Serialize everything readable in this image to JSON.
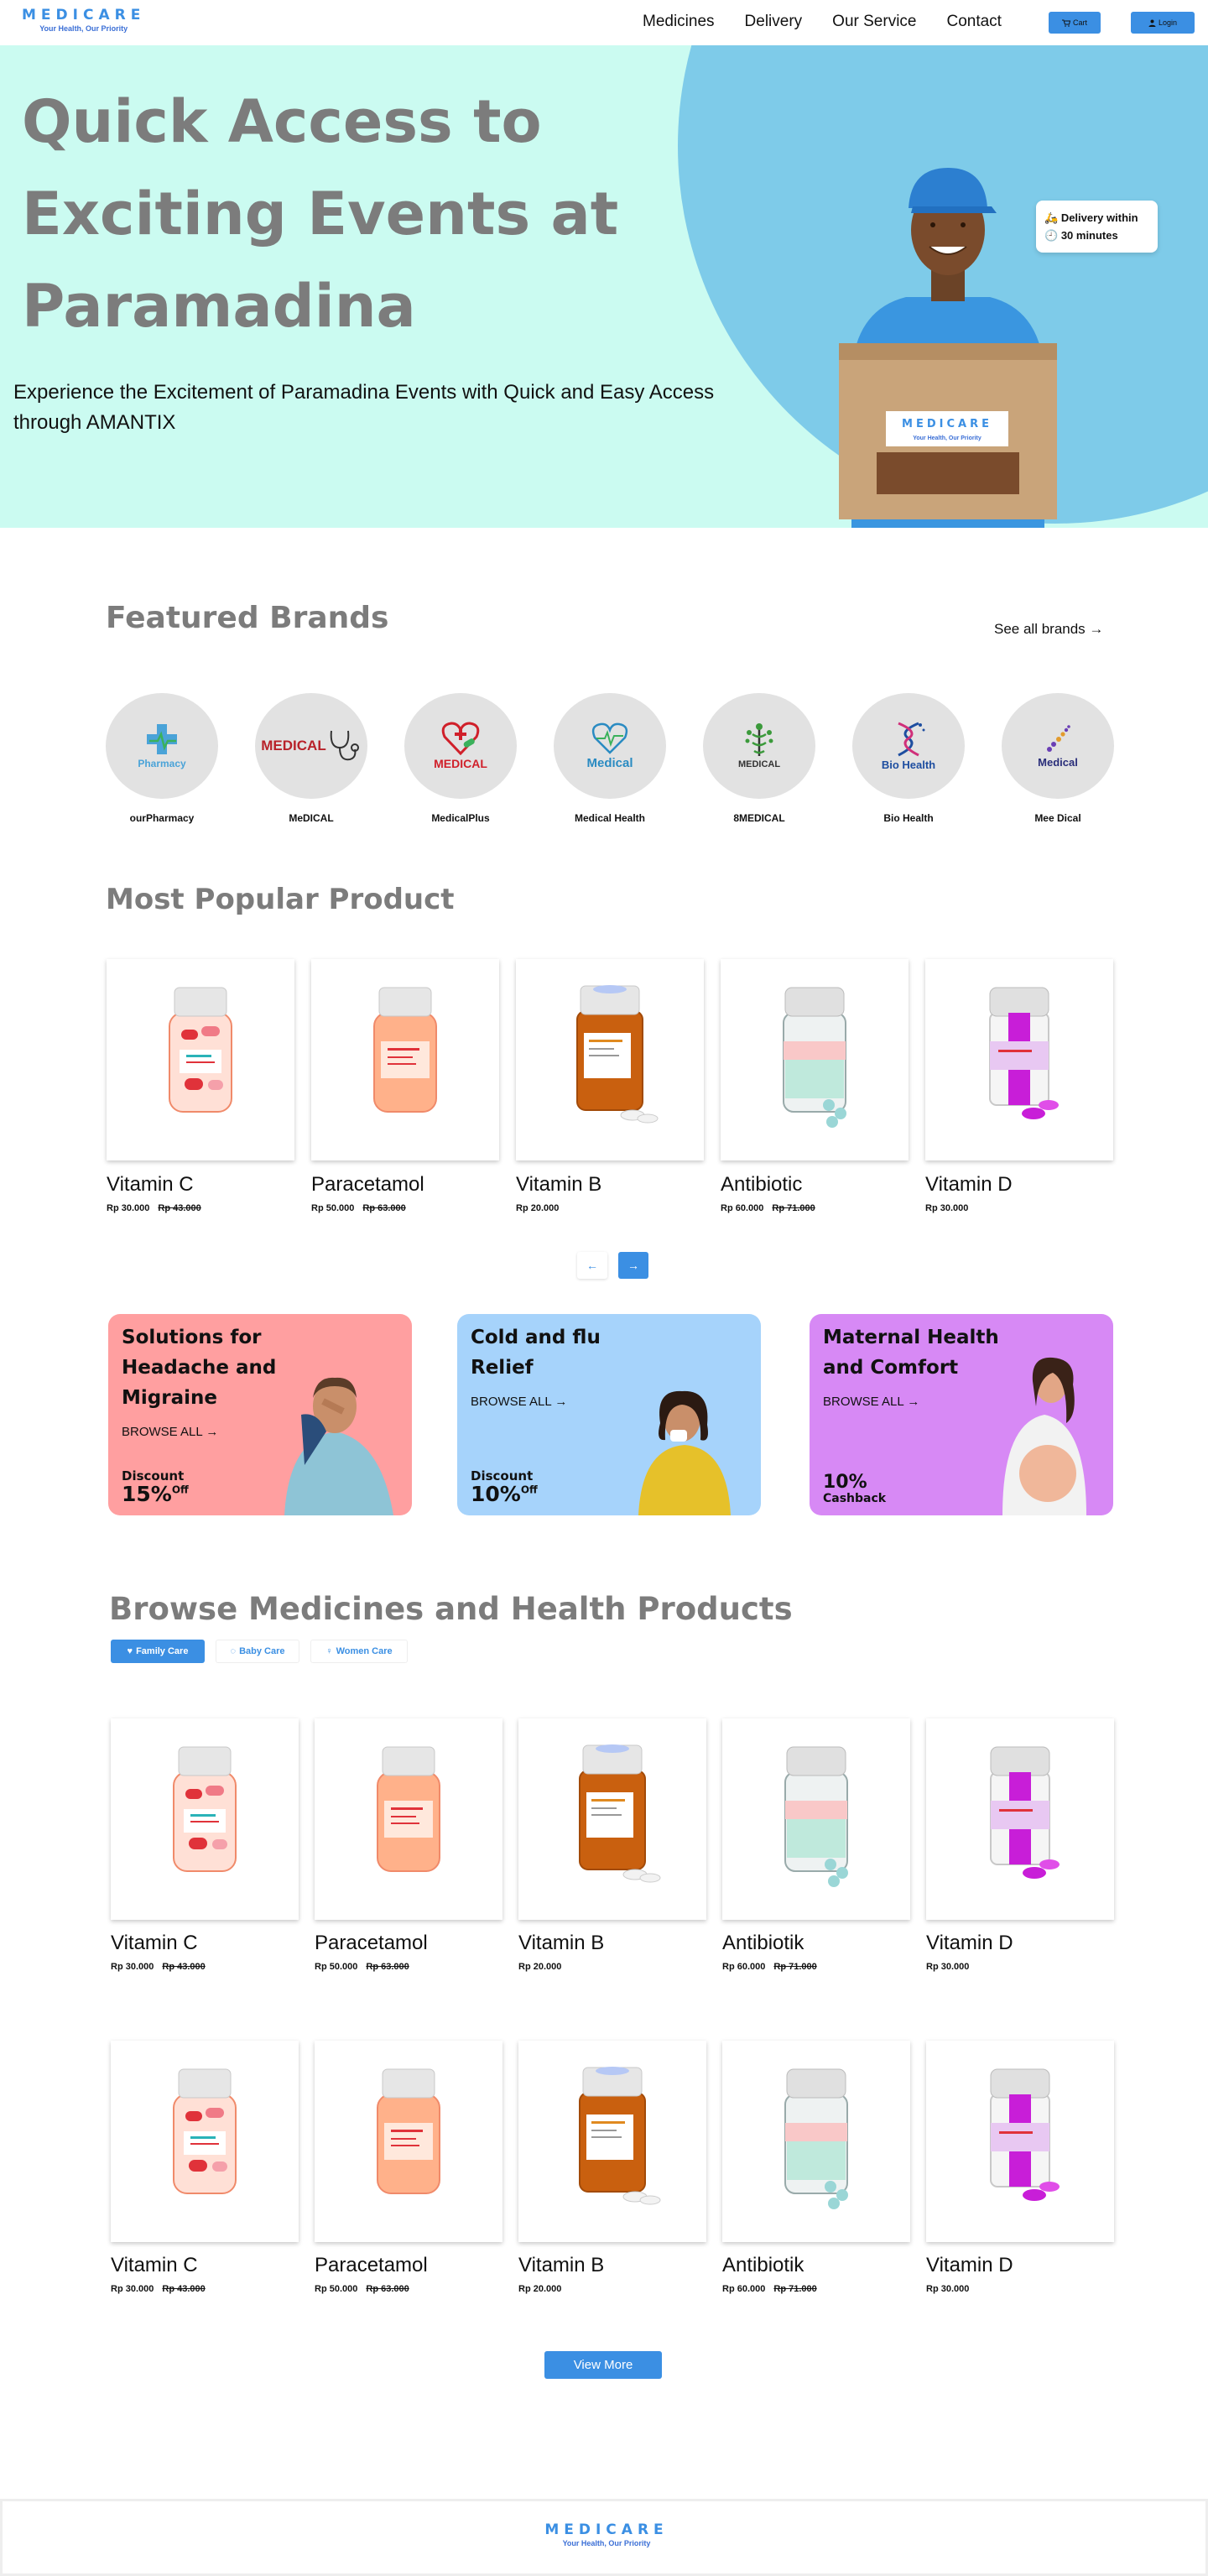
{
  "brand": {
    "name": "MEDICARE",
    "tagline": "Your Health, Our Priority"
  },
  "nav": {
    "links": [
      "Medicines",
      "Delivery",
      "Our Service",
      "Contact"
    ],
    "cart_label": "Cart",
    "login_label": "Login"
  },
  "hero": {
    "title": "Quick Access to Exciting Events at Paramadina",
    "subtitle": "Experience the Excitement of Paramadina Events with Quick and Easy Access through AMANTIX",
    "delivery_line1": "Delivery within",
    "delivery_line2": "30 minutes",
    "box_brand": "MEDICARE",
    "box_tagline": "Your Health, Our Priority"
  },
  "featured": {
    "title": "Featured Brands",
    "see_all": "See all brands →",
    "brands": [
      {
        "name": "ourPharmacy",
        "logo_text": "Pharmacy",
        "logo_color": "#4aa3d8"
      },
      {
        "name": "MeDICAL",
        "logo_text": "MEDICAL",
        "logo_color": "#b8222a"
      },
      {
        "name": "MedicalPlus",
        "logo_text": "MEDICAL",
        "logo_color": "#d0202a"
      },
      {
        "name": "Medical Health",
        "logo_text": "Medical",
        "logo_color": "#2a8bc2"
      },
      {
        "name": "8MEDICAL",
        "logo_text": "MEDICAL",
        "logo_color": "#333333"
      },
      {
        "name": "Bio Health",
        "logo_text": "Bio Health",
        "logo_color": "#1e4ea0"
      },
      {
        "name": "Mee Dical",
        "logo_text": "Medical",
        "logo_color": "#2a2e7a"
      }
    ]
  },
  "popular": {
    "title": "Most Popular Product",
    "products": [
      {
        "name": "Vitamin C",
        "price": "Rp 30.000",
        "old_price": "Rp 43.000",
        "icon": "vitamin-c-bottle"
      },
      {
        "name": "Paracetamol",
        "price": "Rp 50.000",
        "old_price": "Rp 63.000",
        "icon": "paracetamol-bottle"
      },
      {
        "name": "Vitamin B",
        "price": "Rp 20.000",
        "old_price": "",
        "icon": "vitamin-b-bottle"
      },
      {
        "name": "Antibiotic",
        "price": "Rp 60.000",
        "old_price": "Rp 71.000",
        "icon": "antibiotic-bottle"
      },
      {
        "name": "Vitamin D",
        "price": "Rp 30.000",
        "old_price": "",
        "icon": "vitamin-d-bottle"
      }
    ],
    "prev": "←",
    "next": "→"
  },
  "promos": [
    {
      "title": "Solutions for Headache and Migraine",
      "browse": "BROWSE ALL →",
      "disc_label": "Discount",
      "disc_value": "15%",
      "disc_suffix": "Off",
      "color": "#ff9fa0"
    },
    {
      "title": "Cold and flu Relief",
      "browse": "BROWSE ALL →",
      "disc_label": "Discount",
      "disc_value": "10%",
      "disc_suffix": "Off",
      "color": "#a6d3fb"
    },
    {
      "title": "Maternal Health and Comfort",
      "browse": "BROWSE ALL →",
      "disc_label": "Cashback",
      "disc_value": "10%",
      "disc_suffix": "",
      "color": "#d789f5"
    }
  ],
  "browse": {
    "title": "Browse Medicines and Health Products",
    "tabs": [
      "Family Care",
      "Baby Care",
      "Women Care"
    ],
    "products": [
      {
        "name": "Vitamin C",
        "price": "Rp 30.000",
        "old_price": "Rp 43.000",
        "icon": "vitamin-c-bottle"
      },
      {
        "name": "Paracetamol",
        "price": "Rp 50.000",
        "old_price": "Rp 63.000",
        "icon": "paracetamol-bottle"
      },
      {
        "name": "Vitamin B",
        "price": "Rp 20.000",
        "old_price": "",
        "icon": "vitamin-b-bottle"
      },
      {
        "name": "Antibiotik",
        "price": "Rp 60.000",
        "old_price": "Rp 71.000",
        "icon": "antibiotic-bottle"
      },
      {
        "name": "Vitamin D",
        "price": "Rp 30.000",
        "old_price": "",
        "icon": "vitamin-d-bottle"
      }
    ],
    "view_more": "View More"
  },
  "footer": {
    "brand": "MEDICARE",
    "tagline": "Your Health, Our Priority"
  }
}
